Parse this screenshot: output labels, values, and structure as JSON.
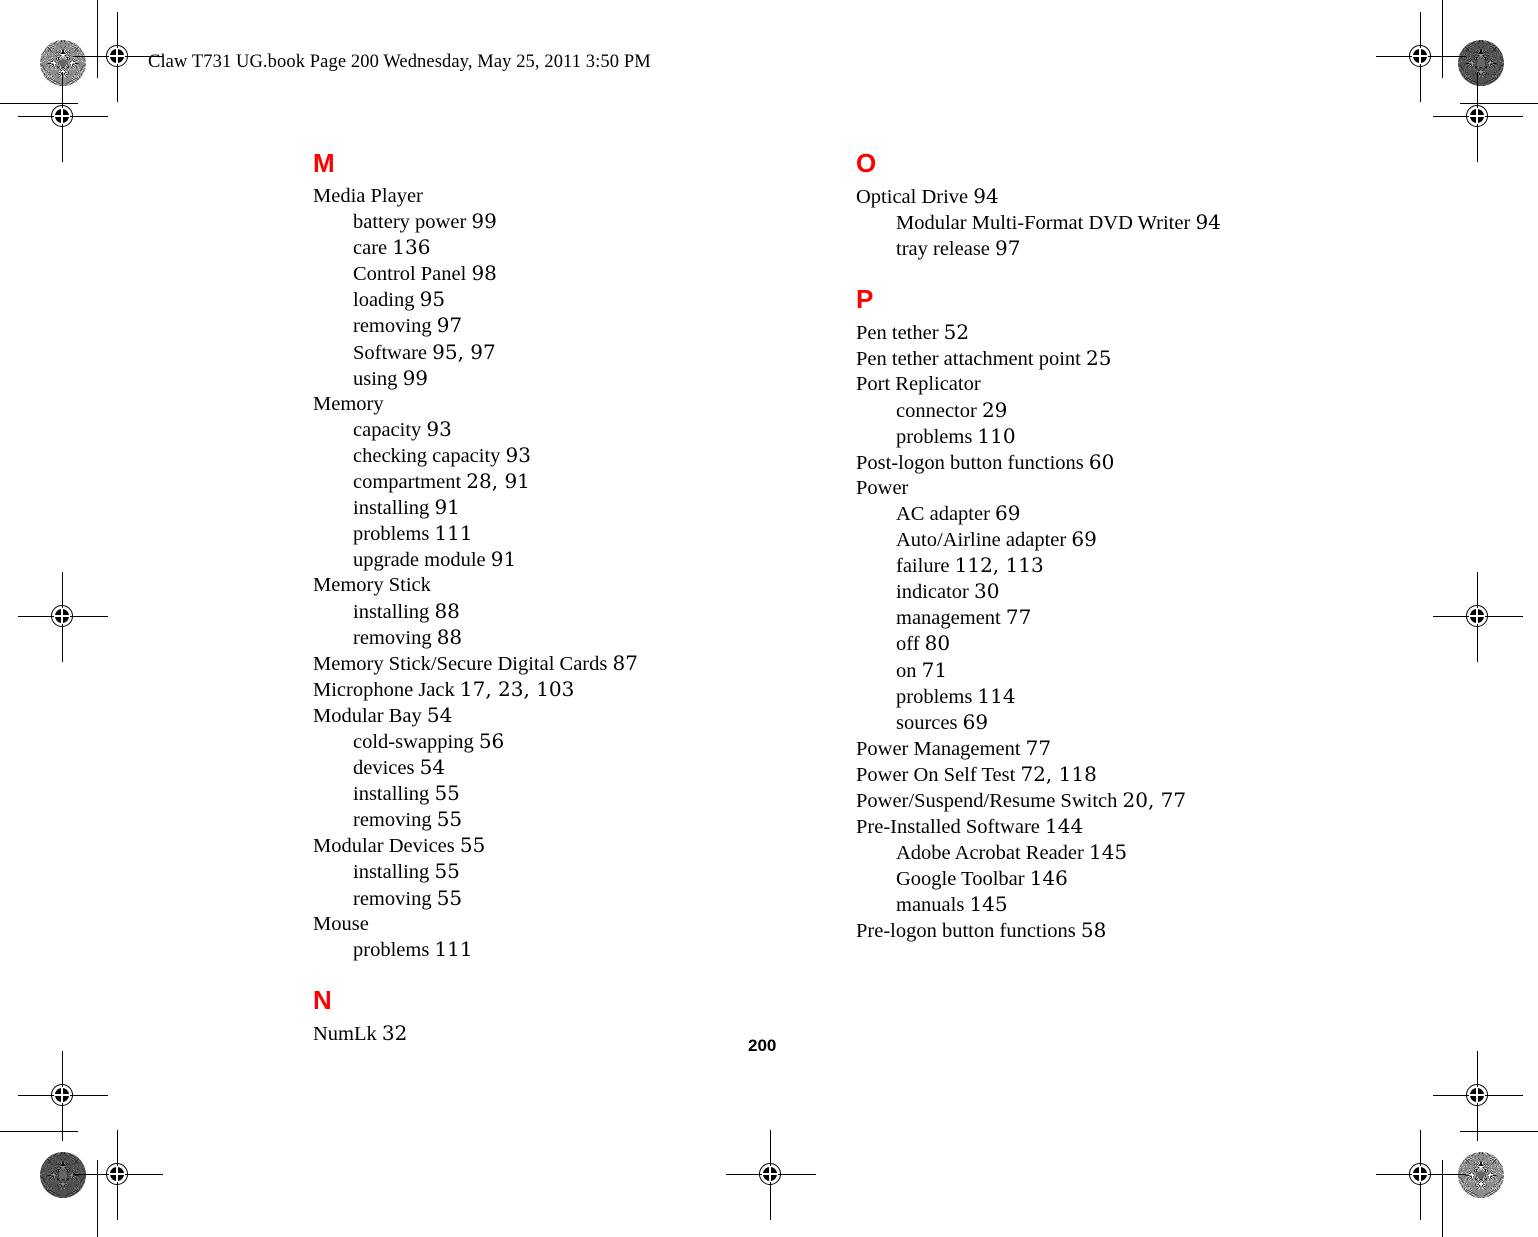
{
  "document": {
    "header_slug": "Claw T731 UG.book  Page 200  Wednesday, May 25, 2011  3:50 PM",
    "folio": "200",
    "heading_color": "#ff0000"
  },
  "index": {
    "columns": [
      {
        "id": "left",
        "groups": [
          {
            "letter": "M",
            "entries": [
              {
                "term": "Media Player",
                "pages": "",
                "level": 0
              },
              {
                "term": "battery power",
                "pages": "99",
                "level": 1
              },
              {
                "term": "care",
                "pages": "136",
                "level": 1
              },
              {
                "term": "Control Panel",
                "pages": "98",
                "level": 1
              },
              {
                "term": "loading",
                "pages": "95",
                "level": 1
              },
              {
                "term": "removing",
                "pages": "97",
                "level": 1
              },
              {
                "term": "Software",
                "pages": "95, 97",
                "level": 1
              },
              {
                "term": "using",
                "pages": "99",
                "level": 1
              },
              {
                "term": "Memory",
                "pages": "",
                "level": 0
              },
              {
                "term": "capacity",
                "pages": "93",
                "level": 1
              },
              {
                "term": "checking capacity",
                "pages": "93",
                "level": 1
              },
              {
                "term": "compartment",
                "pages": "28, 91",
                "level": 1
              },
              {
                "term": "installing",
                "pages": "91",
                "level": 1
              },
              {
                "term": "problems",
                "pages": "111",
                "level": 1
              },
              {
                "term": "upgrade module",
                "pages": "91",
                "level": 1
              },
              {
                "term": "Memory Stick",
                "pages": "",
                "level": 0
              },
              {
                "term": "installing",
                "pages": "88",
                "level": 1
              },
              {
                "term": "removing",
                "pages": "88",
                "level": 1
              },
              {
                "term": "Memory Stick/Secure Digital Cards",
                "pages": "87",
                "level": 0
              },
              {
                "term": "Microphone Jack",
                "pages": "17, 23, 103",
                "level": 0
              },
              {
                "term": "Modular Bay",
                "pages": "54",
                "level": 0
              },
              {
                "term": "cold-swapping",
                "pages": "56",
                "level": 1
              },
              {
                "term": "devices",
                "pages": "54",
                "level": 1
              },
              {
                "term": "installing",
                "pages": "55",
                "level": 1
              },
              {
                "term": "removing",
                "pages": "55",
                "level": 1
              },
              {
                "term": "Modular Devices",
                "pages": "55",
                "level": 0
              },
              {
                "term": "installing",
                "pages": "55",
                "level": 1
              },
              {
                "term": "removing",
                "pages": "55",
                "level": 1
              },
              {
                "term": "Mouse",
                "pages": "",
                "level": 0
              },
              {
                "term": "problems",
                "pages": "111",
                "level": 1
              }
            ]
          },
          {
            "letter": "N",
            "entries": [
              {
                "term": "NumLk",
                "pages": "32",
                "level": 0
              }
            ]
          }
        ]
      },
      {
        "id": "right",
        "groups": [
          {
            "letter": "O",
            "entries": [
              {
                "term": "Optical Drive",
                "pages": "94",
                "level": 0
              },
              {
                "term": "Modular Multi-Format DVD Writer",
                "pages": "94",
                "level": 1
              },
              {
                "term": "tray release",
                "pages": "97",
                "level": 1
              }
            ]
          },
          {
            "letter": "P",
            "entries": [
              {
                "term": "Pen tether",
                "pages": "52",
                "level": 0
              },
              {
                "term": "Pen tether attachment point",
                "pages": "25",
                "level": 0
              },
              {
                "term": "Port Replicator",
                "pages": "",
                "level": 0
              },
              {
                "term": "connector",
                "pages": "29",
                "level": 1
              },
              {
                "term": "problems",
                "pages": "110",
                "level": 1
              },
              {
                "term": "Post-logon button functions",
                "pages": "60",
                "level": 0
              },
              {
                "term": "Power",
                "pages": "",
                "level": 0
              },
              {
                "term": "AC adapter",
                "pages": "69",
                "level": 1
              },
              {
                "term": "Auto/Airline adapter",
                "pages": "69",
                "level": 1
              },
              {
                "term": "failure",
                "pages": "112, 113",
                "level": 1
              },
              {
                "term": "indicator",
                "pages": "30",
                "level": 1
              },
              {
                "term": "management",
                "pages": "77",
                "level": 1
              },
              {
                "term": "off",
                "pages": "80",
                "level": 1
              },
              {
                "term": "on",
                "pages": "71",
                "level": 1
              },
              {
                "term": "problems",
                "pages": "114",
                "level": 1
              },
              {
                "term": "sources",
                "pages": "69",
                "level": 1
              },
              {
                "term": "Power Management",
                "pages": "77",
                "level": 0
              },
              {
                "term": "Power On Self Test",
                "pages": "72, 118",
                "level": 0
              },
              {
                "term": "Power/Suspend/Resume Switch",
                "pages": "20, 77",
                "level": 0
              },
              {
                "term": "Pre-Installed Software",
                "pages": "144",
                "level": 0
              },
              {
                "term": "Adobe Acrobat Reader",
                "pages": "145",
                "level": 1
              },
              {
                "term": "Google Toolbar",
                "pages": "146",
                "level": 1
              },
              {
                "term": "manuals",
                "pages": "145",
                "level": 1
              },
              {
                "term": "Pre-logon button functions",
                "pages": "58",
                "level": 0
              }
            ]
          }
        ]
      }
    ]
  },
  "print_marks": {
    "registration_target": "registration-target",
    "color_star": "color-star-target"
  }
}
